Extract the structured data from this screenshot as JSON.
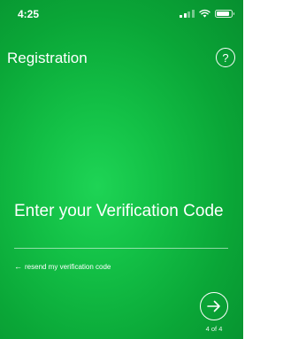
{
  "status_bar": {
    "time": "4:25",
    "signal_icon": "signal-bars-icon",
    "wifi_icon": "wifi-icon",
    "battery_icon": "battery-icon"
  },
  "header": {
    "title": "Registration",
    "help_label": "?"
  },
  "main": {
    "heading": "Enter your Verification Code",
    "code_input": {
      "value": "",
      "placeholder": ""
    },
    "resend_link": {
      "arrow": "←",
      "label": "resend my verification code"
    }
  },
  "footer": {
    "next_icon": "arrow-right-circle-icon",
    "page_indicator": "4 of 4"
  },
  "colors": {
    "background": "#13c046",
    "text": "#ffffff"
  }
}
